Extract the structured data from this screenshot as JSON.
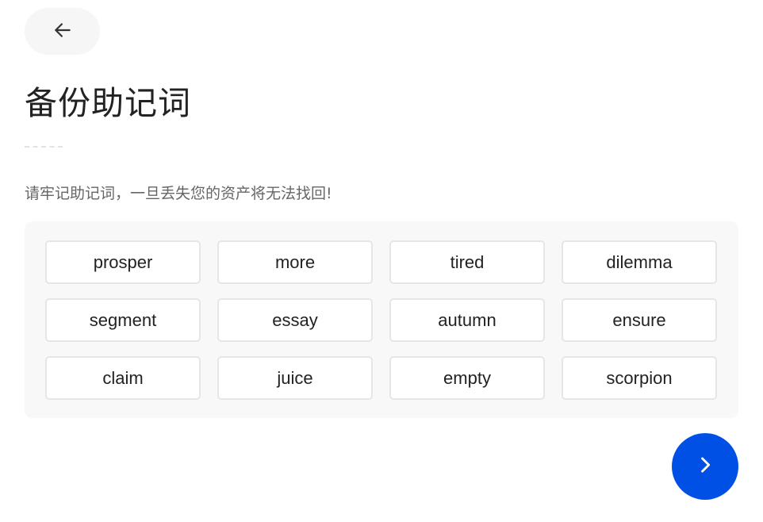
{
  "header": {
    "back_icon": "arrow-left-icon",
    "title": "备份助记词"
  },
  "warning": "请牢记助记词，一旦丢失您的资产将无法找回!",
  "mnemonic": {
    "words": [
      "prosper",
      "more",
      "tired",
      "dilemma",
      "segment",
      "essay",
      "autumn",
      "ensure",
      "claim",
      "juice",
      "empty",
      "scorpion"
    ]
  },
  "footer": {
    "next_icon": "chevron-right-icon",
    "next_color": "#0050e6"
  },
  "colors": {
    "accent": "#0050e6",
    "panel_bg": "#f8f8f8",
    "chip_border": "#e6e6e6"
  }
}
